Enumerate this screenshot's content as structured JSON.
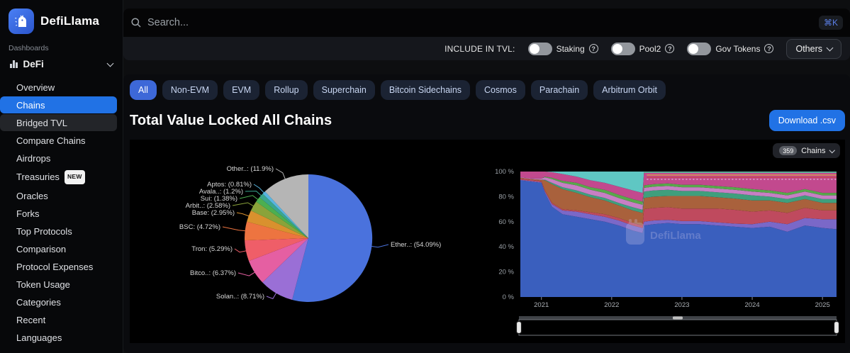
{
  "brand": {
    "name": "DefiLlama"
  },
  "search": {
    "placeholder": "Search...",
    "shortcut": "⌘K"
  },
  "tvl_bar": {
    "label": "INCLUDE IN TVL:",
    "toggles": [
      {
        "label": "Staking",
        "on": false
      },
      {
        "label": "Pool2",
        "on": false
      },
      {
        "label": "Gov Tokens",
        "on": false
      }
    ],
    "others_label": "Others"
  },
  "sidebar": {
    "section_label": "Dashboards",
    "selector": "DeFi",
    "items": [
      {
        "label": "Overview"
      },
      {
        "label": "Chains",
        "active": true
      },
      {
        "label": "Bridged TVL",
        "hover": true
      },
      {
        "label": "Compare Chains"
      },
      {
        "label": "Airdrops"
      },
      {
        "label": "Treasuries",
        "badge": "NEW"
      },
      {
        "label": "Oracles"
      },
      {
        "label": "Forks"
      },
      {
        "label": "Top Protocols"
      },
      {
        "label": "Comparison"
      },
      {
        "label": "Protocol Expenses"
      },
      {
        "label": "Token Usage"
      },
      {
        "label": "Categories"
      },
      {
        "label": "Recent"
      },
      {
        "label": "Languages"
      }
    ]
  },
  "tabs": [
    {
      "label": "All",
      "active": true
    },
    {
      "label": "Non-EVM"
    },
    {
      "label": "EVM"
    },
    {
      "label": "Rollup"
    },
    {
      "label": "Superchain"
    },
    {
      "label": "Bitcoin Sidechains"
    },
    {
      "label": "Cosmos"
    },
    {
      "label": "Parachain"
    },
    {
      "label": "Arbitrum Orbit"
    }
  ],
  "main": {
    "title": "Total Value Locked All Chains",
    "download_label": "Download .csv",
    "chains_count": "359",
    "chains_label": "Chains",
    "watermark": "DefiLlama"
  },
  "colors": {
    "accent": "#2172e5",
    "panel_bg": "#000000",
    "active_tab": "#3d68d8"
  },
  "chart_data": [
    {
      "type": "pie",
      "title": "TVL share by chain",
      "slices": [
        {
          "name": "Ether..",
          "label": "Ether..: (54.09%)",
          "value": 54.09,
          "color": "#4a72dd"
        },
        {
          "name": "Solan..",
          "label": "Solan..: (8.71%)",
          "value": 8.71,
          "color": "#9a6fd6"
        },
        {
          "name": "Bitco..",
          "label": "Bitco..: (6.37%)",
          "value": 6.37,
          "color": "#e55fa2"
        },
        {
          "name": "Tron",
          "label": "Tron: (5.29%)",
          "value": 5.29,
          "color": "#ef5e68"
        },
        {
          "name": "BSC",
          "label": "BSC: (4.72%)",
          "value": 4.72,
          "color": "#ed7440"
        },
        {
          "name": "Base",
          "label": "Base: (2.95%)",
          "value": 2.95,
          "color": "#d9912e"
        },
        {
          "name": "Arbit..",
          "label": "Arbit..: (2.58%)",
          "value": 2.58,
          "color": "#8aa33a"
        },
        {
          "name": "Sui",
          "label": "Sui: (1.38%)",
          "value": 1.38,
          "color": "#4caf50"
        },
        {
          "name": "Avala..",
          "label": "Avala..: (1.2%)",
          "value": 1.2,
          "color": "#3aa68d"
        },
        {
          "name": "Aptos",
          "label": "Aptos: (0.81%)",
          "value": 0.81,
          "color": "#58b5e0"
        },
        {
          "name": "Other..",
          "label": "Other..: (11.9%)",
          "value": 11.9,
          "color": "#b5b5b5"
        }
      ]
    },
    {
      "type": "area",
      "stacked_percent": true,
      "ylim": [
        0,
        100
      ],
      "y_ticks": [
        "0 %",
        "20 %",
        "40 %",
        "60 %",
        "80 %",
        "100 %"
      ],
      "x_ticks": [
        "2021",
        "2022",
        "2023",
        "2024",
        "2025"
      ],
      "x_tick_years": [
        2021,
        2022,
        2023,
        2024,
        2025
      ],
      "x_range": [
        2020.68,
        2025.2
      ],
      "x": [
        2020.7,
        2020.85,
        2021.0,
        2021.05,
        2021.15,
        2021.3,
        2021.5,
        2021.7,
        2021.9,
        2022.1,
        2022.3,
        2022.44,
        2022.46,
        2022.6,
        2022.8,
        2023.0,
        2023.25,
        2023.5,
        2023.75,
        2024.0,
        2024.25,
        2024.5,
        2024.75,
        2025.0,
        2025.2
      ],
      "series": [
        {
          "name": "band-blue",
          "color": "#3a5fbe",
          "values": [
            93,
            92,
            91,
            83,
            72,
            66,
            64,
            62,
            60,
            57,
            53,
            51,
            57,
            58,
            59,
            58,
            58,
            57,
            56,
            55,
            56,
            52,
            57,
            55,
            54
          ]
        },
        {
          "name": "band-purple",
          "color": "#7a68c8",
          "values": [
            0.5,
            0.5,
            0.5,
            1,
            2,
            3,
            4,
            4,
            4,
            4,
            4,
            4,
            3,
            3,
            2.5,
            2.5,
            2.5,
            2.5,
            2.5,
            3,
            4,
            6,
            6,
            7,
            8
          ]
        },
        {
          "name": "band-red",
          "color": "#bf4a5e",
          "values": [
            1,
            1,
            1,
            1,
            1,
            1,
            1,
            1.5,
            2,
            2,
            2,
            2,
            10,
            10,
            10,
            10,
            10,
            11,
            11,
            10,
            9,
            9,
            8,
            7,
            7
          ]
        },
        {
          "name": "band-brown",
          "color": "#a9613c",
          "values": [
            0.5,
            0.5,
            1,
            8,
            15,
            16,
            14,
            12,
            11,
            10,
            10,
            10,
            9,
            9,
            9,
            10,
            10,
            9,
            9,
            9,
            8,
            8,
            7,
            6,
            6
          ]
        },
        {
          "name": "band-teal-green",
          "color": "#3f9f7d",
          "values": [
            0,
            0,
            0,
            0.5,
            1,
            1.5,
            2,
            2,
            2,
            2,
            2.5,
            2.5,
            5,
            5,
            5,
            4,
            4,
            4,
            4,
            4,
            3,
            3,
            3,
            3,
            3
          ]
        },
        {
          "name": "band-orchid",
          "color": "#c77fc4",
          "values": [
            0.5,
            0.5,
            1,
            2,
            3,
            3.5,
            4,
            4,
            4,
            4,
            4,
            4,
            3,
            3,
            3,
            3,
            3,
            3,
            3,
            3,
            3,
            3,
            3,
            3,
            3
          ]
        },
        {
          "name": "band-green",
          "color": "#58a84b",
          "values": [
            0,
            0,
            0,
            0.5,
            1,
            1.5,
            2,
            2,
            2.5,
            2.5,
            2.5,
            2.5,
            2,
            2,
            2,
            2,
            2,
            2,
            2,
            2,
            2,
            2,
            2,
            2,
            2
          ]
        },
        {
          "name": "band-others",
          "color": "#c2498e",
          "values": [
            4.5,
            5.5,
            5.5,
            4,
            4.5,
            5.5,
            5,
            5.5,
            5.5,
            6.5,
            7,
            7,
            10.7,
            9.7,
            9.2,
            10.2,
            10.2,
            11.2,
            12.2,
            13.7,
            14.7,
            16.7,
            13.7,
            16.7,
            16.7
          ]
        },
        {
          "name": "band-cyan-terra",
          "color": "#5fc7c3",
          "values": [
            0,
            0,
            0,
            0,
            0.5,
            2,
            4,
            7,
            9,
            12,
            15,
            17,
            0.3,
            0.3,
            0.3,
            0.3,
            0.3,
            0.3,
            0.3,
            0.3,
            0.3,
            0.3,
            0.3,
            0.3,
            0.3
          ]
        }
      ]
    }
  ]
}
